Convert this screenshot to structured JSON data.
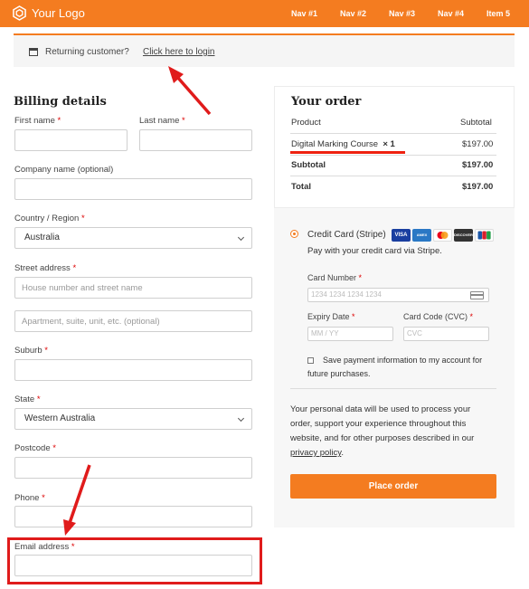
{
  "header": {
    "logo_text": "Your Logo",
    "nav": [
      "Nav #1",
      "Nav #2",
      "Nav #3",
      "Nav #4",
      "Item 5"
    ],
    "brand_color": "#f47c20"
  },
  "notice": {
    "text": "Returning customer?",
    "link": "Click here to login"
  },
  "billing": {
    "title": "Billing details",
    "required_mark": "*",
    "first_name": "First name",
    "last_name": "Last name",
    "company": "Company name (optional)",
    "country": "Country / Region",
    "country_value": "Australia",
    "street": "Street address",
    "street_ph1": "House number and street name",
    "street_ph2": "Apartment, suite, unit, etc. (optional)",
    "suburb": "Suburb",
    "state": "State",
    "state_value": "Western Australia",
    "postcode": "Postcode",
    "phone": "Phone",
    "email": "Email address"
  },
  "order": {
    "title": "Your order",
    "col_product": "Product",
    "col_subtotal": "Subtotal",
    "item_name": "Digital Marking Course",
    "item_qty": "× 1",
    "item_price": "$197.00",
    "subtotal_label": "Subtotal",
    "subtotal_value": "$197.00",
    "total_label": "Total",
    "total_value": "$197.00"
  },
  "payment": {
    "method": "Credit Card (Stripe)",
    "description": "Pay with your credit card via Stripe.",
    "card_badges": [
      "VISA",
      "AMEX",
      "MC",
      "DISCOVER",
      "JCB"
    ],
    "card_number_label": "Card Number",
    "card_number_ph": "1234 1234 1234 1234",
    "expiry_label": "Expiry Date",
    "expiry_ph": "MM / YY",
    "cvc_label": "Card Code (CVC)",
    "cvc_ph": "CVC",
    "save_line1": "Save payment information to my account for",
    "save_line2": "future purchases.",
    "privacy_line1": "Your personal data will be used to process your",
    "privacy_line2": "order, support your experience throughout this",
    "privacy_line3": "website, and for other purposes described in our",
    "privacy_link": "privacy policy",
    "privacy_end": ".",
    "place_order": "Place order"
  },
  "annotation_color": "#e01b1b"
}
